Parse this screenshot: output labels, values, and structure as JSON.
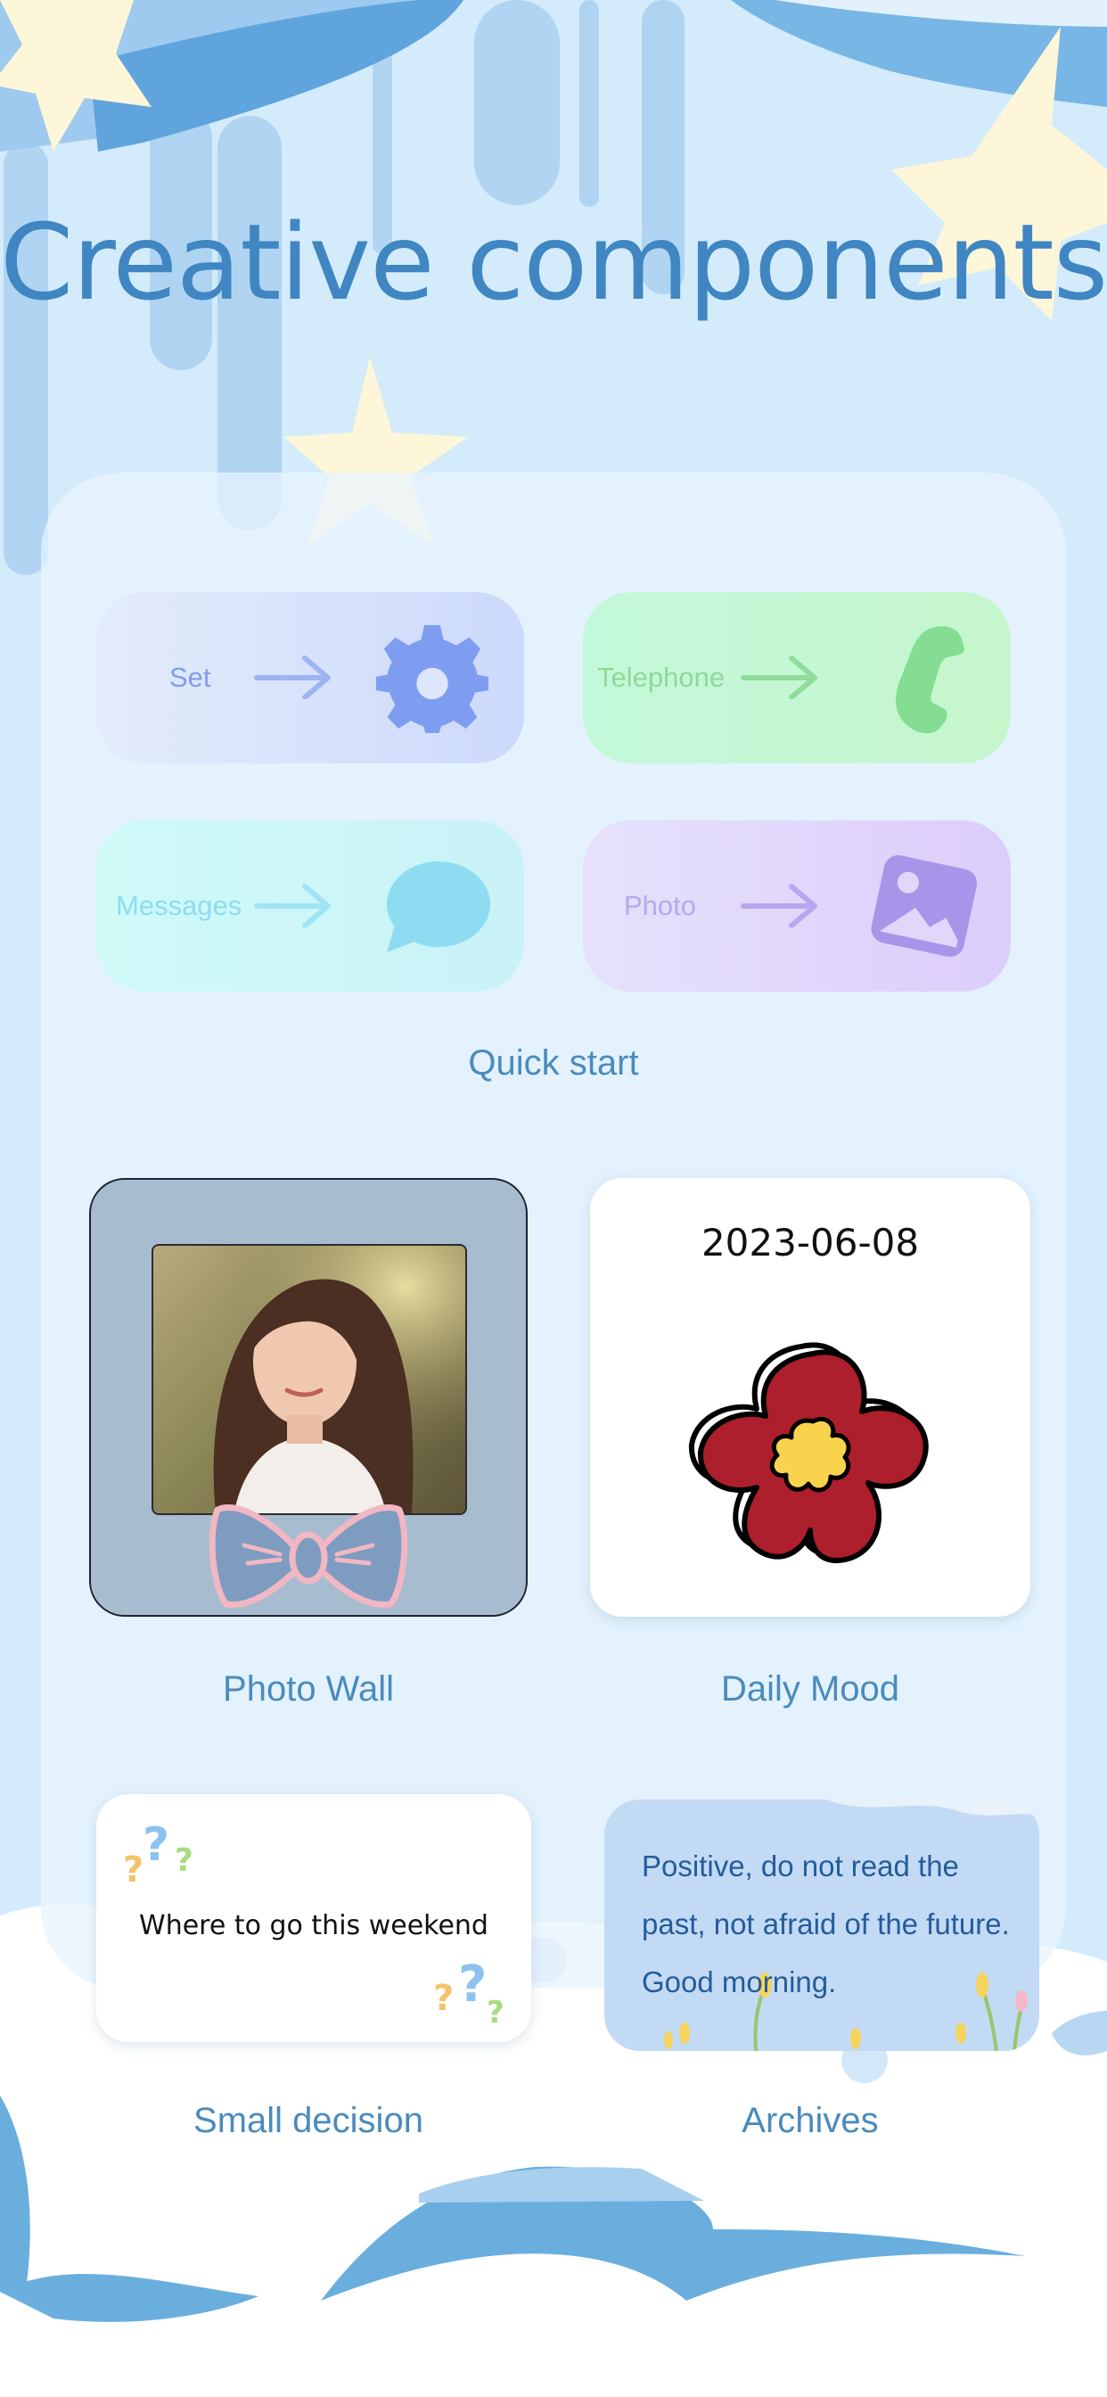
{
  "title": "Creative components",
  "quick_start": {
    "label": "Quick start",
    "items": [
      {
        "label": "Set",
        "icon": "gear-icon",
        "color": "#7f9df0"
      },
      {
        "label": "Telephone",
        "icon": "phone-icon",
        "color": "#84dd92"
      },
      {
        "label": "Messages",
        "icon": "message-bubble-icon",
        "color": "#8ddcf2"
      },
      {
        "label": "Photo",
        "icon": "photo-icon",
        "color": "#a895ea"
      }
    ]
  },
  "widgets": {
    "photo_wall": {
      "label": "Photo Wall"
    },
    "daily_mood": {
      "label": "Daily Mood",
      "date": "2023-06-08"
    },
    "small_decision": {
      "label": "Small decision",
      "question": "Where to go this weekend"
    },
    "archives": {
      "label": "Archives",
      "quote": "Positive, do not read the past, not afraid of the future. Good morning."
    }
  },
  "colors": {
    "background": "#d3ebfb",
    "title": "#3f86c2",
    "caption": "#4a8bbd",
    "accent_blue": "#6aaede",
    "star": "#fdf6d8"
  }
}
